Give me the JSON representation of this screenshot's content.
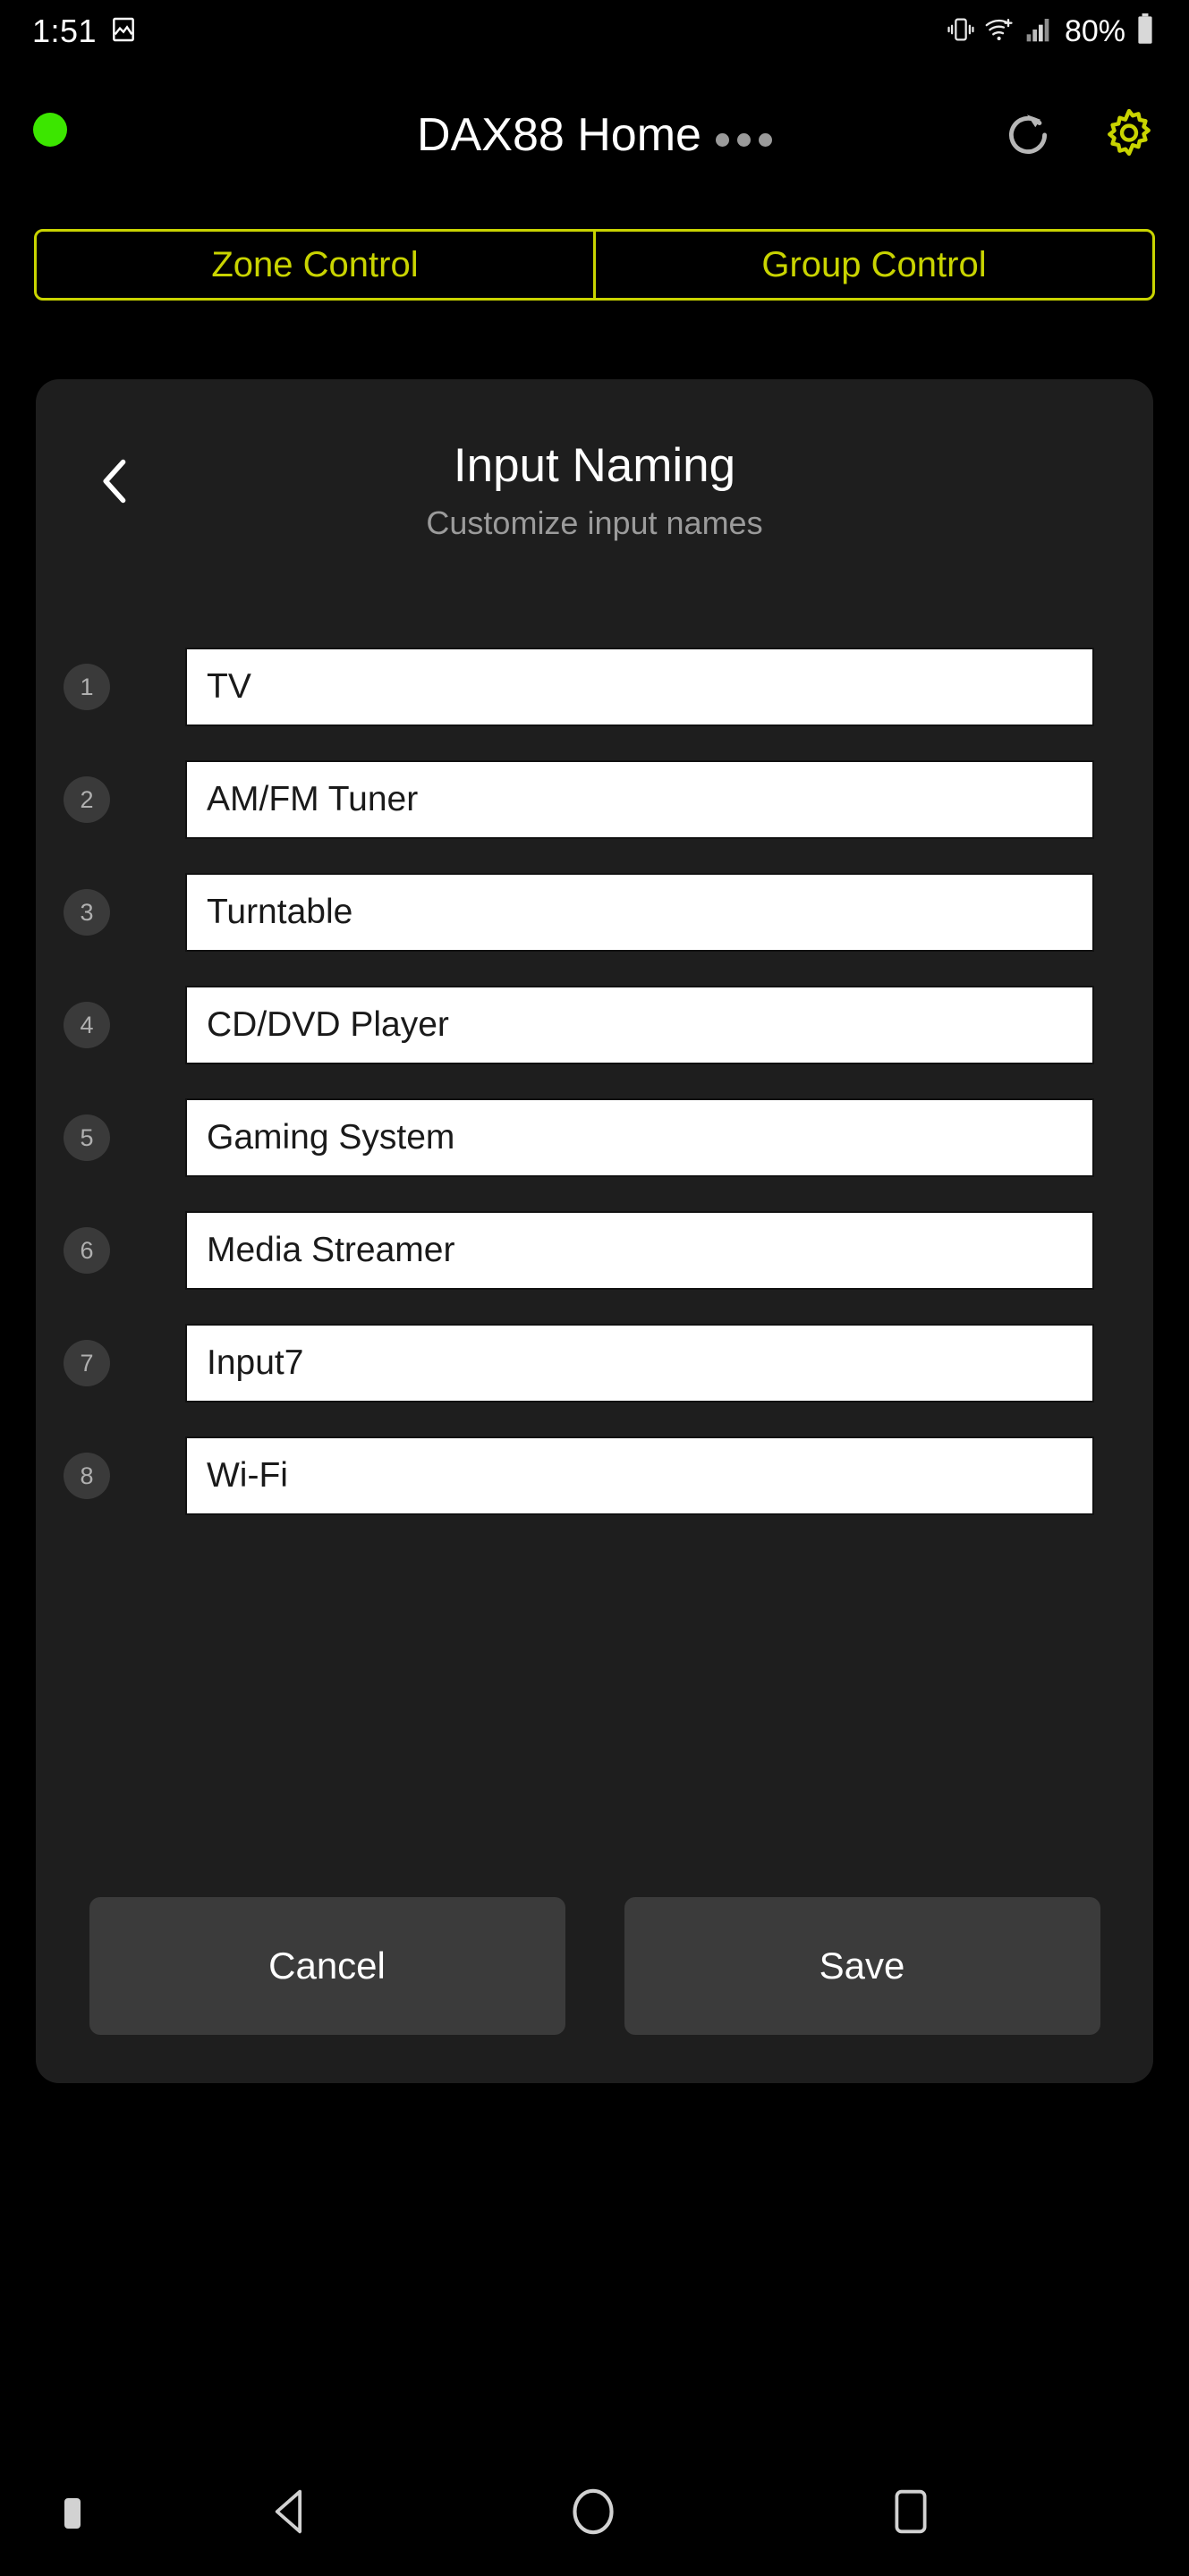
{
  "statusbar": {
    "time": "1:51",
    "battery_pct": "80%",
    "icons": [
      "image-icon",
      "vibrate-icon",
      "wifi-add-icon",
      "signal-bars-icon",
      "battery-icon"
    ]
  },
  "appbar": {
    "status_dot": "connected-indicator",
    "title": "DAX88 Home",
    "overflow": "•••",
    "refresh_icon": "refresh-icon",
    "settings_icon": "gear-icon",
    "accent_color": "#c9d400",
    "status_color": "#3ce600"
  },
  "tabs": [
    {
      "label": "Zone Control",
      "selected": true
    },
    {
      "label": "Group Control",
      "selected": false
    }
  ],
  "card": {
    "back_icon": "chevron-left-icon",
    "title": "Input Naming",
    "subtitle": "Customize input names"
  },
  "inputs": [
    {
      "num": "1",
      "value": "TV"
    },
    {
      "num": "2",
      "value": "AM/FM Tuner"
    },
    {
      "num": "3",
      "value": "Turntable"
    },
    {
      "num": "4",
      "value": "CD/DVD Player"
    },
    {
      "num": "5",
      "value": "Gaming System"
    },
    {
      "num": "6",
      "value": "Media Streamer"
    },
    {
      "num": "7",
      "value": "Input7"
    },
    {
      "num": "8",
      "value": "Wi-Fi"
    }
  ],
  "actions": {
    "cancel_label": "Cancel",
    "save_label": "Save"
  },
  "navbar": {
    "dot": "keyboard-indicator-icon",
    "back": "back-triangle-icon",
    "home": "home-circle-icon",
    "recents": "recents-square-icon"
  }
}
